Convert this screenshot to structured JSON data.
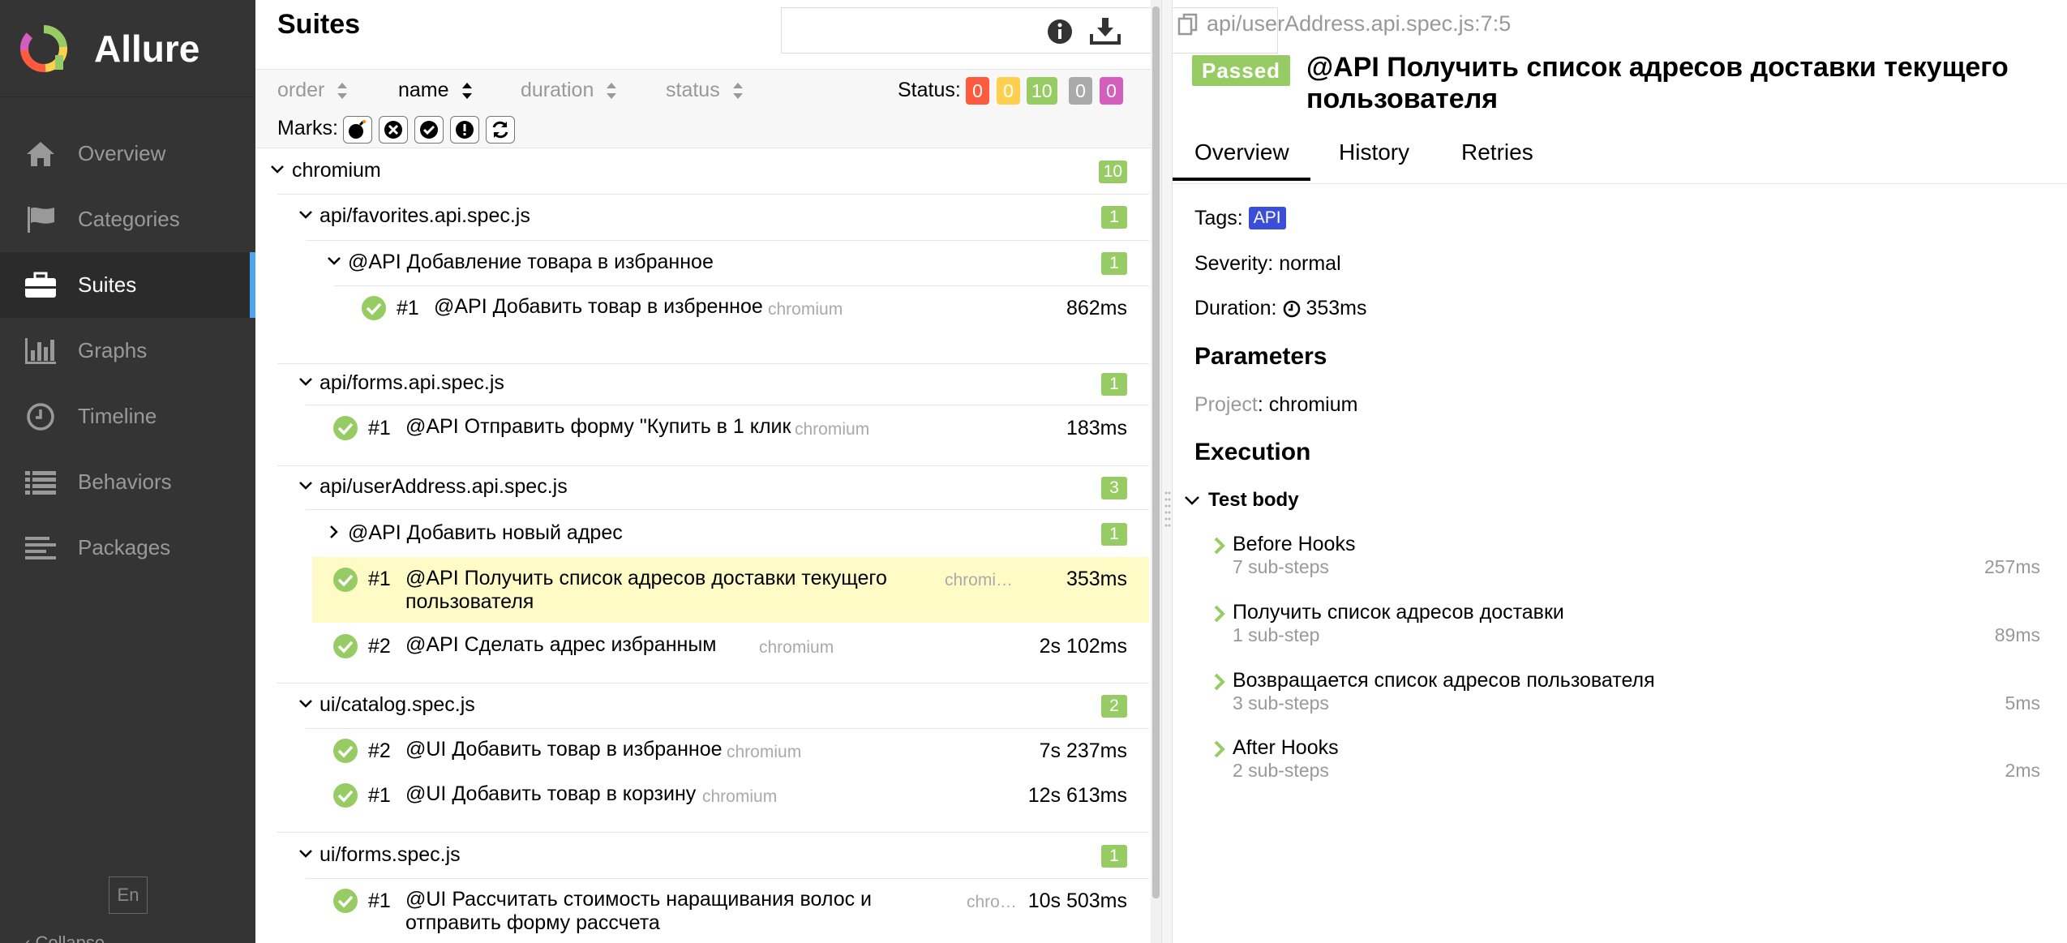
{
  "app": {
    "name": "Allure",
    "nav": [
      {
        "label": "Overview",
        "icon": "home-icon"
      },
      {
        "label": "Categories",
        "icon": "flag-icon"
      },
      {
        "label": "Suites",
        "icon": "briefcase-icon",
        "active": true
      },
      {
        "label": "Graphs",
        "icon": "bar-chart-icon"
      },
      {
        "label": "Timeline",
        "icon": "clock-icon"
      },
      {
        "label": "Behaviors",
        "icon": "list-icon"
      },
      {
        "label": "Packages",
        "icon": "align-left-icon"
      }
    ],
    "language": "En",
    "collapse_label": "Collapse"
  },
  "suites": {
    "title": "Suites",
    "search": {
      "value": "",
      "placeholder": ""
    },
    "sorters": {
      "order": "order",
      "name": "name",
      "duration": "duration",
      "status": "status"
    },
    "status_label": "Status:",
    "statuses": [
      {
        "name": "failed",
        "count": "0",
        "color": "#fd5a3e"
      },
      {
        "name": "broken",
        "count": "0",
        "color": "#ffd050"
      },
      {
        "name": "passed",
        "count": "10",
        "color": "#97cc64"
      },
      {
        "name": "skipped",
        "count": "0",
        "color": "#aaaaaa"
      },
      {
        "name": "unknown",
        "count": "0",
        "color": "#d35ebe"
      }
    ],
    "marks_label": "Marks:",
    "marks": [
      "bomb-icon",
      "times-circle-icon",
      "check-circle-icon",
      "exclamation-circle-icon",
      "refresh-icon"
    ],
    "tree": {
      "root": {
        "name": "chromium",
        "count": "10"
      },
      "favorites": {
        "name": "api/favorites.api.spec.js",
        "count": "1",
        "sub": {
          "name": "@API Добавление товара в избранное",
          "count": "1"
        },
        "tests": [
          {
            "num": "#1",
            "name": "@API Добавить товар в избренное",
            "project": "chromium",
            "duration": "862ms"
          }
        ]
      },
      "forms": {
        "name": "api/forms.api.spec.js",
        "count": "1",
        "tests": [
          {
            "num": "#1",
            "name": "@API Отправить форму \"Купить в 1 клик",
            "project": "chromium",
            "duration": "183ms"
          }
        ]
      },
      "userAddress": {
        "name": "api/userAddress.api.spec.js",
        "count": "3",
        "sub": {
          "name": "@API Добавить новый адрес",
          "count": "1"
        },
        "tests": [
          {
            "num": "#1",
            "name": "@API Получить список адресов доставки текущего пользователя",
            "project": "chromi…",
            "duration": "353ms"
          },
          {
            "num": "#2",
            "name": "@API Сделать адрес избранным",
            "project": "chromium",
            "duration": "2s 102ms"
          }
        ]
      },
      "catalog": {
        "name": "ui/catalog.spec.js",
        "count": "2",
        "tests": [
          {
            "num": "#2",
            "name": "@UI Добавить товар в избранное",
            "project": "chromium",
            "duration": "7s 237ms"
          },
          {
            "num": "#1",
            "name": "@UI Добавить товар в корзину",
            "project": "chromium",
            "duration": "12s 613ms"
          }
        ]
      },
      "uiForms": {
        "name": "ui/forms.spec.js",
        "count": "1",
        "tests": [
          {
            "num": "#1",
            "name": "@UI Рассчитать стоимость наращивания волос и отправить форму рассчета",
            "project": "chro…",
            "duration": "10s 503ms"
          }
        ]
      }
    }
  },
  "detail": {
    "path": "api/userAddress.api.spec.js:7:5",
    "status": "Passed",
    "title": "@API Получить список адресов доставки текущего пользователя",
    "tabs": [
      "Overview",
      "History",
      "Retries"
    ],
    "tags_label": "Tags:",
    "tag": "API",
    "severity_label": "Severity:",
    "severity": "normal",
    "duration_label": "Duration:",
    "duration": "353ms",
    "parameters_title": "Parameters",
    "param_name": "Project",
    "param_value": "chromium",
    "execution_title": "Execution",
    "test_body": "Test body",
    "steps": [
      {
        "name": "Before Hooks",
        "sub": "7 sub-steps",
        "time": "257ms"
      },
      {
        "name": "Получить список адресов доставки",
        "sub": "1 sub-step",
        "time": "89ms"
      },
      {
        "name": "Возвращается список адресов пользователя",
        "sub": "3 sub-steps",
        "time": "5ms"
      },
      {
        "name": "After Hooks",
        "sub": "2 sub-steps",
        "time": "2ms"
      }
    ]
  },
  "colors": {
    "passed": "#97cc64",
    "sidebar": "#343434",
    "selected_row": "#fffbc6",
    "tag": "#3b4ed8"
  }
}
